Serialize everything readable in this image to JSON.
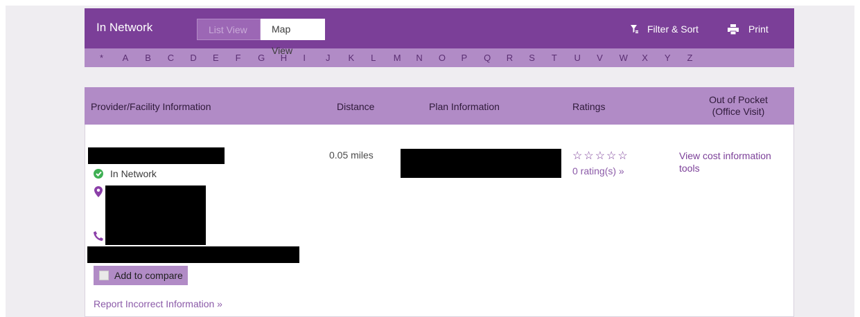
{
  "topbar": {
    "title": "In Network",
    "list_view_label": "List View",
    "map_view_label": "Map View",
    "filter_label": "Filter & Sort",
    "print_label": "Print"
  },
  "alphabet": [
    "*",
    "A",
    "B",
    "C",
    "D",
    "E",
    "F",
    "G",
    "H",
    "I",
    "J",
    "K",
    "L",
    "M",
    "N",
    "O",
    "P",
    "Q",
    "R",
    "S",
    "T",
    "U",
    "V",
    "W",
    "X",
    "Y",
    "Z"
  ],
  "table_header": {
    "provider": "Provider/Facility Information",
    "distance": "Distance",
    "plan": "Plan Information",
    "ratings": "Ratings",
    "out_of_pocket_line1": "Out of Pocket",
    "out_of_pocket_line2": "(Office Visit)"
  },
  "result": {
    "network_status": "In Network",
    "distance": "0.05 miles",
    "stars": "☆☆☆☆☆",
    "rating_count": "0 rating(s) »",
    "cost_link": "View cost information tools",
    "compare_label": "Add to compare",
    "report_link": "Report Incorrect Information »"
  },
  "colors": {
    "brand_purple": "#7b3f98",
    "light_purple": "#b18bc6",
    "in_network_green": "#3fb054"
  }
}
